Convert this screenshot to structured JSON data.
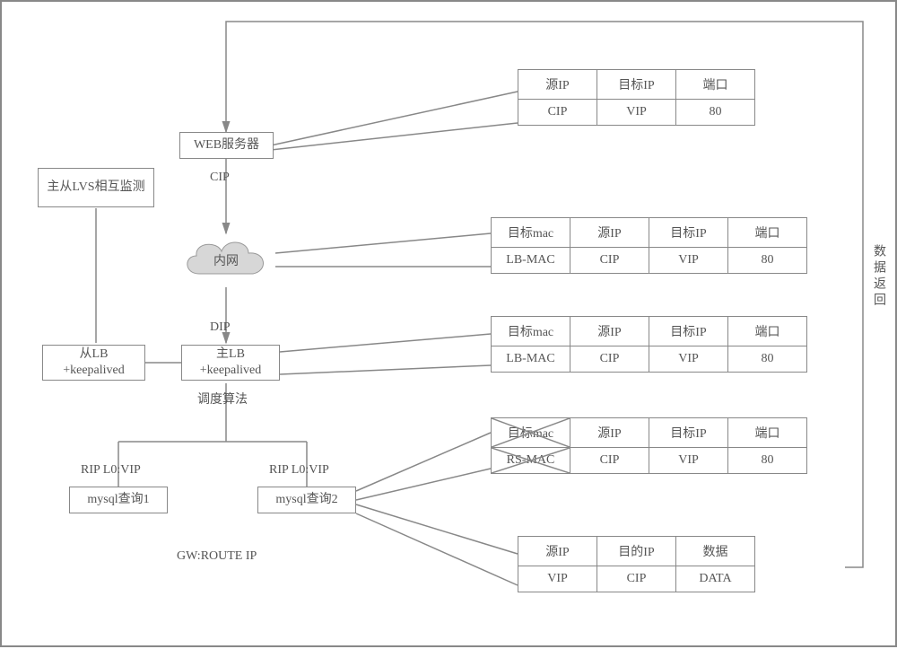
{
  "nodes": {
    "monitor": "主从LVS相互监测",
    "web_server": "WEB服务器",
    "cloud": "内网",
    "slave_lb": "从LB\n+keepalived",
    "master_lb": "主LB\n+keepalived",
    "mysql1": "mysql查询1",
    "mysql2": "mysql查询2"
  },
  "labels": {
    "cip": "CIP",
    "dip": "DIP",
    "sched": "调度算法",
    "rip_lo_vip_1": "RIP L0:VIP",
    "rip_lo_vip_2": "RIP L0:VIP",
    "gw": "GW:ROUTE IP",
    "return": "数据返回"
  },
  "tables": {
    "t1": {
      "headers": [
        "源IP",
        "目标IP",
        "端口"
      ],
      "row": [
        "CIP",
        "VIP",
        "80"
      ]
    },
    "t2": {
      "headers": [
        "目标mac",
        "源IP",
        "目标IP",
        "端口"
      ],
      "row": [
        "LB-MAC",
        "CIP",
        "VIP",
        "80"
      ]
    },
    "t3": {
      "headers": [
        "目标mac",
        "源IP",
        "目标IP",
        "端口"
      ],
      "row": [
        "LB-MAC",
        "CIP",
        "VIP",
        "80"
      ]
    },
    "t4": {
      "headers": [
        "目标mac",
        "源IP",
        "目标IP",
        "端口"
      ],
      "row": [
        "RS-MAC",
        "CIP",
        "VIP",
        "80"
      ],
      "struck": true
    },
    "t5": {
      "headers": [
        "源IP",
        "目的IP",
        "数据"
      ],
      "row": [
        "VIP",
        "CIP",
        "DATA"
      ]
    }
  }
}
